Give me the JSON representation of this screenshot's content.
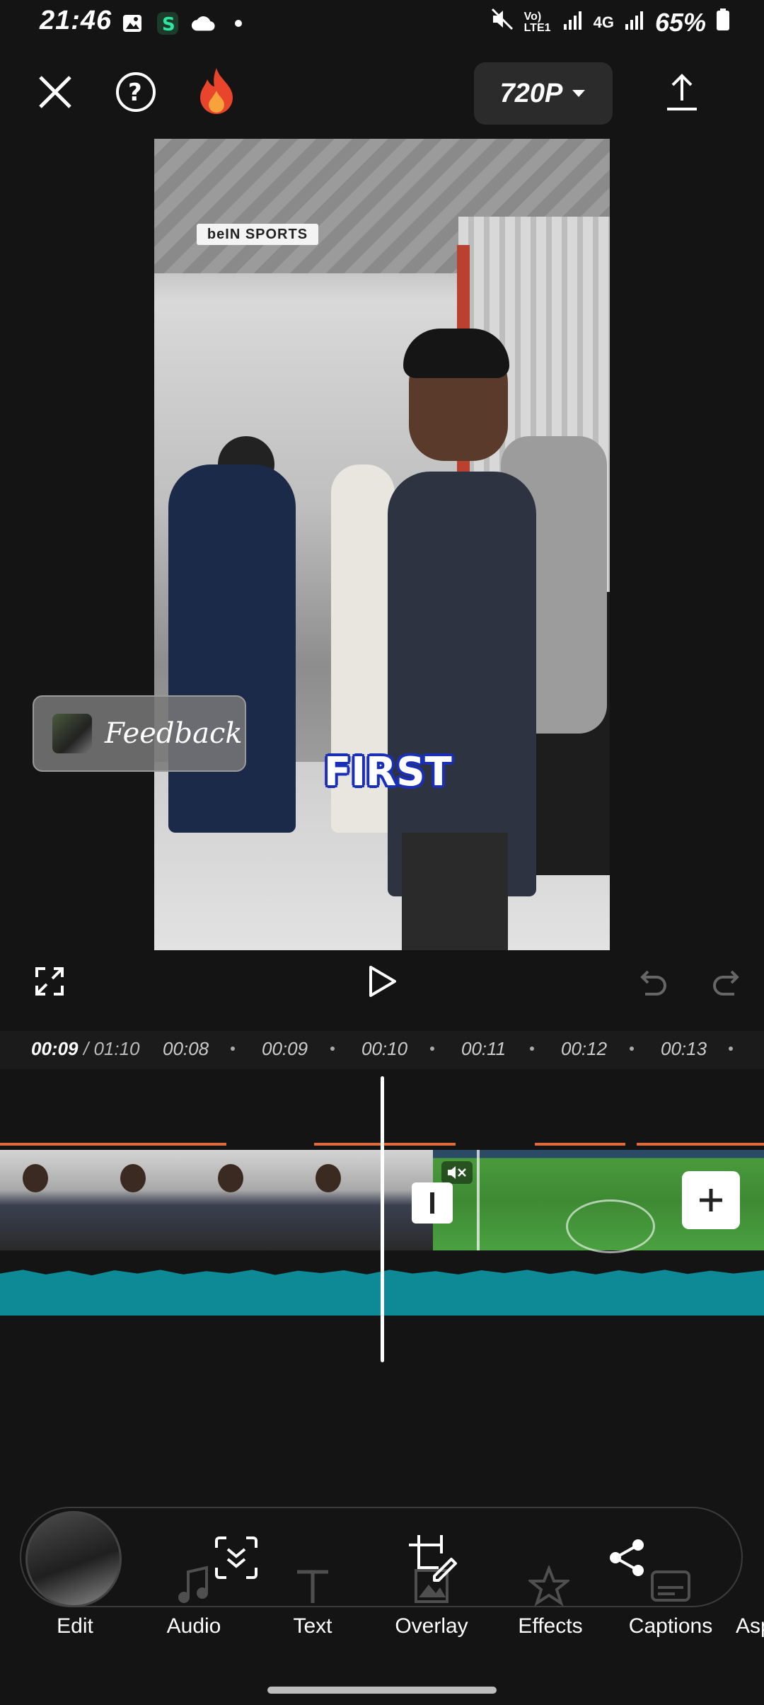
{
  "status_bar": {
    "time": "21:46",
    "network": "4G",
    "volte": "Vo) LTE1",
    "battery": "65%"
  },
  "top_bar": {
    "resolution": "720P"
  },
  "preview": {
    "broadcast_logo": "beIN SPORTS",
    "caption": "FIRST"
  },
  "feedback": {
    "label": "Feedback"
  },
  "timeline": {
    "current_time": "00:09",
    "total_time": "/ 01:10",
    "ticks": [
      "00:08",
      "00:09",
      "00:10",
      "00:11",
      "00:12",
      "00:13"
    ]
  },
  "toolbar": {
    "items": [
      {
        "label": "Edit"
      },
      {
        "label": "Audio"
      },
      {
        "label": "Text"
      },
      {
        "label": "Overlay"
      },
      {
        "label": "Effects"
      },
      {
        "label": "Captions"
      },
      {
        "label": "Asp"
      }
    ]
  },
  "colors": {
    "accent_audio": "#0e8a96",
    "clip_marker": "#e06a3a",
    "flame": "#e8452c"
  }
}
